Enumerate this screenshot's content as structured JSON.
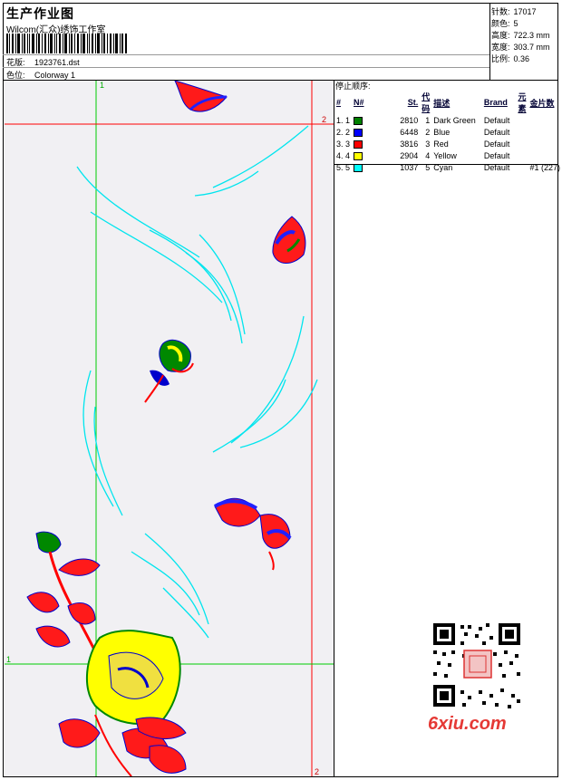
{
  "header": {
    "title": "生产作业图",
    "company": "Wilcom(汇众)绣饰工作室",
    "design_label": "花版:",
    "design_value": "1923761.dst",
    "colorway_label": "色位:",
    "colorway_value": "Colorway 1"
  },
  "specs": [
    {
      "label": "针数:",
      "value": "17017"
    },
    {
      "label": "颜色:",
      "value": "5"
    },
    {
      "label": "高度:",
      "value": "722.3 mm"
    },
    {
      "label": "宽度:",
      "value": "303.7 mm"
    },
    {
      "label": "比例:",
      "value": "0.36"
    }
  ],
  "stops": {
    "title": "停止顺序:",
    "columns": [
      "#",
      "N#",
      "St.",
      "代码",
      "描述",
      "Brand",
      "元素",
      "金片数"
    ],
    "rows": [
      {
        "num": "1.",
        "n": "1",
        "color": "#008000",
        "code_num": "2810",
        "code": "1",
        "desc": "Dark Green",
        "brand": "Default",
        "elem": "",
        "seq": ""
      },
      {
        "num": "2.",
        "n": "2",
        "color": "#0000ff",
        "code_num": "6448",
        "code": "2",
        "desc": "Blue",
        "brand": "Default",
        "elem": "",
        "seq": ""
      },
      {
        "num": "3.",
        "n": "3",
        "color": "#ff0000",
        "code_num": "3816",
        "code": "3",
        "desc": "Red",
        "brand": "Default",
        "elem": "",
        "seq": ""
      },
      {
        "num": "4.",
        "n": "4",
        "color": "#ffff00",
        "code_num": "2904",
        "code": "4",
        "desc": "Yellow",
        "brand": "Default",
        "elem": "",
        "seq": ""
      },
      {
        "num": "5.",
        "n": "5",
        "color": "#00ffff",
        "code_num": "1037",
        "code": "5",
        "desc": "Cyan",
        "brand": "Default",
        "elem": "",
        "seq": "#1 (227)"
      }
    ]
  },
  "canvas": {
    "guide_labels": {
      "v1": "1",
      "v2": "2",
      "h1": "1",
      "h2": "2"
    },
    "colors": {
      "guide_green": "#00cc00",
      "guide_red": "#ff0000"
    }
  },
  "watermark": "6xiu.com"
}
